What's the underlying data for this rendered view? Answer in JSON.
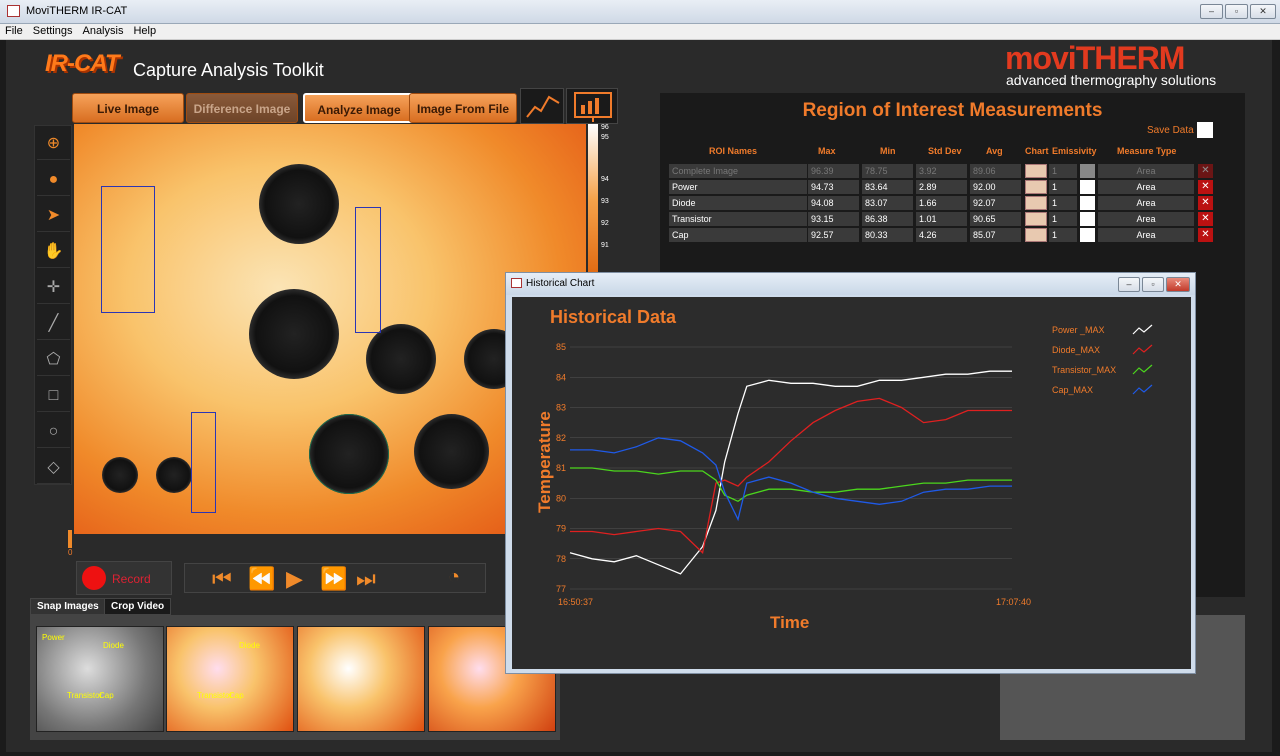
{
  "window": {
    "title": "MoviTHERM IR-CAT",
    "buttons": [
      "–",
      "▫",
      "✕"
    ]
  },
  "menu": [
    "File",
    "Settings",
    "Analysis",
    "Help"
  ],
  "header": {
    "logo": "IR-CAT",
    "subtitle": "Capture Analysis Toolkit",
    "brand": "moviTHERM",
    "brand_sub": "advanced thermography solutions"
  },
  "tabs": [
    {
      "label": "Live Image"
    },
    {
      "label": "Difference Image"
    },
    {
      "label": "Analyze Image"
    },
    {
      "label": "Image From File"
    }
  ],
  "scale": [
    "96",
    "95",
    "94",
    "93",
    "92",
    "91"
  ],
  "slider_value": "0",
  "record_label": "Record",
  "snap_tabs": [
    "Snap Images",
    "Crop Video"
  ],
  "thumbs": [
    {
      "labels": [
        "Power",
        "Diode",
        "Transistor",
        "Cap"
      ]
    },
    {
      "labels": [
        "Diode",
        "Transistor",
        "Cap"
      ]
    },
    {
      "labels": []
    },
    {
      "labels": []
    }
  ],
  "roi": {
    "title": "Region of Interest  Measurements",
    "save_label": "Save Data",
    "headers": [
      "ROI Names",
      "Max",
      "Min",
      "Std Dev",
      "Avg",
      "Chart",
      "Emissivity",
      "Measure Type"
    ],
    "rows": [
      {
        "name": "Complete Image",
        "max": "96.39",
        "min": "78.75",
        "std": "3.92",
        "avg": "89.06",
        "emis": "1",
        "type": "Area",
        "dim": true
      },
      {
        "name": "Power",
        "max": "94.73",
        "min": "83.64",
        "std": "2.89",
        "avg": "92.00",
        "emis": "1",
        "type": "Area"
      },
      {
        "name": "Diode",
        "max": "94.08",
        "min": "83.07",
        "std": "1.66",
        "avg": "92.07",
        "emis": "1",
        "type": "Area"
      },
      {
        "name": "Transistor",
        "max": "93.15",
        "min": "86.38",
        "std": "1.01",
        "avg": "90.65",
        "emis": "1",
        "type": "Area"
      },
      {
        "name": "Cap",
        "max": "92.57",
        "min": "80.33",
        "std": "4.26",
        "avg": "85.07",
        "emis": "1",
        "type": "Area"
      }
    ]
  },
  "hist_window": {
    "title": "Historical Chart"
  },
  "chart_data": {
    "type": "line",
    "title": "Historical Data",
    "xlabel": "Time",
    "ylabel": "Temperature",
    "x_ticks": [
      "16:50:37",
      "17:07:40"
    ],
    "ylim": [
      77,
      85
    ],
    "y_ticks": [
      77,
      78,
      79,
      80,
      81,
      82,
      83,
      84,
      85
    ],
    "grid": true,
    "legend": "right",
    "x": [
      0,
      0.05,
      0.1,
      0.15,
      0.2,
      0.25,
      0.3,
      0.33,
      0.35,
      0.38,
      0.4,
      0.45,
      0.5,
      0.55,
      0.6,
      0.65,
      0.7,
      0.75,
      0.8,
      0.85,
      0.9,
      0.95,
      1
    ],
    "series": [
      {
        "name": "Power _MAX",
        "color": "#ffffff",
        "values": [
          78.2,
          78.0,
          77.9,
          78.1,
          77.8,
          77.5,
          78.4,
          79.6,
          81.2,
          82.8,
          83.7,
          83.9,
          83.8,
          83.8,
          83.7,
          83.7,
          83.9,
          83.9,
          84.0,
          84.1,
          84.1,
          84.2,
          84.2
        ]
      },
      {
        "name": "Diode_MAX",
        "color": "#e02020",
        "values": [
          78.9,
          78.9,
          78.8,
          78.9,
          79.0,
          78.9,
          78.2,
          80.5,
          80.6,
          80.4,
          80.7,
          81.2,
          81.9,
          82.5,
          82.9,
          83.2,
          83.3,
          83.0,
          82.5,
          82.6,
          82.9,
          82.9,
          82.9
        ]
      },
      {
        "name": "Transistor_MAX",
        "color": "#4bd61d",
        "values": [
          81.0,
          81.0,
          80.9,
          80.9,
          80.8,
          80.9,
          80.9,
          80.6,
          80.1,
          79.9,
          80.1,
          80.3,
          80.3,
          80.2,
          80.2,
          80.3,
          80.3,
          80.4,
          80.5,
          80.5,
          80.6,
          80.6,
          80.6
        ]
      },
      {
        "name": "Cap_MAX",
        "color": "#1f5ae8",
        "values": [
          81.6,
          81.6,
          81.5,
          81.7,
          82.0,
          81.9,
          81.5,
          81.1,
          80.2,
          79.3,
          80.5,
          80.7,
          80.5,
          80.2,
          80.0,
          79.9,
          79.8,
          79.9,
          80.2,
          80.3,
          80.3,
          80.4,
          80.4
        ]
      }
    ]
  }
}
